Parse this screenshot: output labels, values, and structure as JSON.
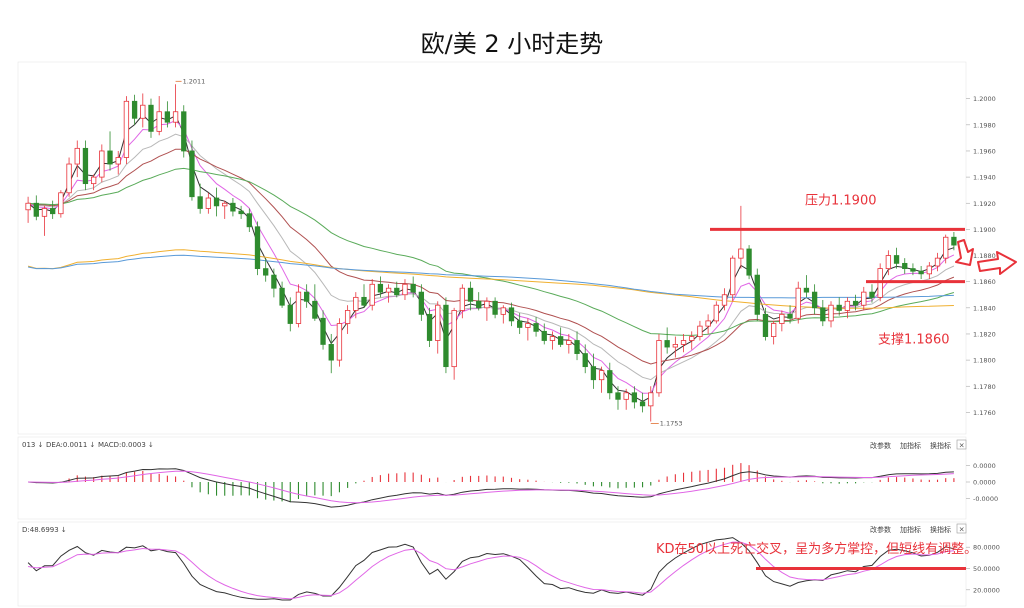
{
  "title": "欧/美 2 小时走势",
  "chart_data": {
    "type": "candlestick",
    "main_panel": {
      "ylim": [
        1.1745,
        1.2025
      ],
      "y_ticks": [
        "1.2000",
        "1.1980",
        "1.1960",
        "1.1940",
        "1.1920",
        "1.1900",
        "1.1880",
        "1.1860",
        "1.1840",
        "1.1820",
        "1.1800",
        "1.1780",
        "1.1760"
      ],
      "high_marker": "1.2011",
      "low_marker": "1.1753",
      "candles": [
        [
          1.1915,
          1.1925,
          1.1905,
          1.192
        ],
        [
          1.192,
          1.1926,
          1.1907,
          1.191
        ],
        [
          1.191,
          1.1918,
          1.1895,
          1.1916
        ],
        [
          1.1916,
          1.1922,
          1.1908,
          1.1912
        ],
        [
          1.1912,
          1.193,
          1.1909,
          1.1928
        ],
        [
          1.1928,
          1.1955,
          1.1925,
          1.195
        ],
        [
          1.195,
          1.1968,
          1.194,
          1.1962
        ],
        [
          1.1962,
          1.1968,
          1.193,
          1.1935
        ],
        [
          1.1935,
          1.1942,
          1.193,
          1.194
        ],
        [
          1.194,
          1.1965,
          1.1936,
          1.196
        ],
        [
          1.196,
          1.1975,
          1.1945,
          1.195
        ],
        [
          1.195,
          1.196,
          1.1942,
          1.1955
        ],
        [
          1.1955,
          1.2002,
          1.195,
          1.1998
        ],
        [
          1.1998,
          1.2003,
          1.198,
          1.1985
        ],
        [
          1.1985,
          1.2004,
          1.1978,
          1.1995
        ],
        [
          1.1995,
          1.2,
          1.197,
          1.1975
        ],
        [
          1.1975,
          1.2002,
          1.1972,
          1.199
        ],
        [
          1.199,
          1.1998,
          1.1978,
          1.1982
        ],
        [
          1.1982,
          1.2011,
          1.1978,
          1.199
        ],
        [
          1.199,
          1.1995,
          1.1955,
          1.196
        ],
        [
          1.196,
          1.1968,
          1.1922,
          1.1925
        ],
        [
          1.1925,
          1.1935,
          1.1912,
          1.1916
        ],
        [
          1.1916,
          1.1928,
          1.1912,
          1.1924
        ],
        [
          1.1924,
          1.1932,
          1.191,
          1.1918
        ],
        [
          1.1918,
          1.1922,
          1.1908,
          1.192
        ],
        [
          1.192,
          1.1924,
          1.191,
          1.1914
        ],
        [
          1.1914,
          1.1918,
          1.1908,
          1.1912
        ],
        [
          1.1912,
          1.1916,
          1.1898,
          1.1902
        ],
        [
          1.1902,
          1.1906,
          1.1865,
          1.187
        ],
        [
          1.187,
          1.1878,
          1.186,
          1.1865
        ],
        [
          1.1865,
          1.187,
          1.1848,
          1.1855
        ],
        [
          1.1855,
          1.186,
          1.184,
          1.1842
        ],
        [
          1.1842,
          1.1848,
          1.1822,
          1.1828
        ],
        [
          1.1828,
          1.1858,
          1.1825,
          1.1852
        ],
        [
          1.1852,
          1.1858,
          1.184,
          1.1845
        ],
        [
          1.1845,
          1.1858,
          1.183,
          1.1832
        ],
        [
          1.1832,
          1.1838,
          1.1808,
          1.1812
        ],
        [
          1.1812,
          1.182,
          1.179,
          1.18
        ],
        [
          1.18,
          1.1832,
          1.1795,
          1.1828
        ],
        [
          1.1828,
          1.1842,
          1.182,
          1.1838
        ],
        [
          1.1838,
          1.1852,
          1.1832,
          1.1848
        ],
        [
          1.1848,
          1.1858,
          1.184,
          1.1842
        ],
        [
          1.1842,
          1.1862,
          1.1838,
          1.1858
        ],
        [
          1.1858,
          1.1864,
          1.1848,
          1.1852
        ],
        [
          1.1852,
          1.1858,
          1.1844,
          1.1855
        ],
        [
          1.1855,
          1.186,
          1.1848,
          1.185
        ],
        [
          1.185,
          1.1862,
          1.1846,
          1.1858
        ],
        [
          1.1858,
          1.1864,
          1.1848,
          1.1852
        ],
        [
          1.1852,
          1.1858,
          1.183,
          1.1835
        ],
        [
          1.1835,
          1.184,
          1.181,
          1.1815
        ],
        [
          1.1815,
          1.1845,
          1.1805,
          1.1842
        ],
        [
          1.1842,
          1.1848,
          1.179,
          1.1795
        ],
        [
          1.1795,
          1.184,
          1.1785,
          1.1838
        ],
        [
          1.1838,
          1.1858,
          1.1832,
          1.1855
        ],
        [
          1.1855,
          1.186,
          1.1838,
          1.1845
        ],
        [
          1.1845,
          1.1852,
          1.1838,
          1.184
        ],
        [
          1.184,
          1.1848,
          1.183,
          1.1845
        ],
        [
          1.1845,
          1.1848,
          1.1832,
          1.1835
        ],
        [
          1.1835,
          1.1842,
          1.1828,
          1.184
        ],
        [
          1.184,
          1.1844,
          1.1826,
          1.183
        ],
        [
          1.183,
          1.1836,
          1.182,
          1.1825
        ],
        [
          1.1825,
          1.1832,
          1.1815,
          1.1828
        ],
        [
          1.1828,
          1.1833,
          1.1818,
          1.1822
        ],
        [
          1.1822,
          1.1828,
          1.1812,
          1.1815
        ],
        [
          1.1815,
          1.1822,
          1.1808,
          1.1818
        ],
        [
          1.1818,
          1.1825,
          1.181,
          1.1812
        ],
        [
          1.1812,
          1.182,
          1.1805,
          1.1815
        ],
        [
          1.1815,
          1.1822,
          1.18,
          1.1805
        ],
        [
          1.1805,
          1.1812,
          1.179,
          1.1795
        ],
        [
          1.1795,
          1.1805,
          1.1778,
          1.1785
        ],
        [
          1.1785,
          1.1795,
          1.1775,
          1.1792
        ],
        [
          1.1792,
          1.1798,
          1.177,
          1.1775
        ],
        [
          1.1775,
          1.178,
          1.1762,
          1.177
        ],
        [
          1.177,
          1.1778,
          1.1762,
          1.1775
        ],
        [
          1.1775,
          1.178,
          1.1763,
          1.1768
        ],
        [
          1.1768,
          1.1775,
          1.176,
          1.1765
        ],
        [
          1.1765,
          1.178,
          1.1753,
          1.1775
        ],
        [
          1.1775,
          1.182,
          1.1772,
          1.1815
        ],
        [
          1.1815,
          1.1825,
          1.1805,
          1.181
        ],
        [
          1.181,
          1.1818,
          1.1802,
          1.1812
        ],
        [
          1.1812,
          1.182,
          1.1806,
          1.1815
        ],
        [
          1.1815,
          1.1822,
          1.1808,
          1.1818
        ],
        [
          1.1818,
          1.183,
          1.1815,
          1.1826
        ],
        [
          1.1826,
          1.1835,
          1.182,
          1.183
        ],
        [
          1.183,
          1.1845,
          1.1828,
          1.1842
        ],
        [
          1.1842,
          1.1855,
          1.1838,
          1.185
        ],
        [
          1.185,
          1.188,
          1.1845,
          1.1878
        ],
        [
          1.1878,
          1.1918,
          1.187,
          1.1885
        ],
        [
          1.1885,
          1.1888,
          1.1862,
          1.1865
        ],
        [
          1.1865,
          1.187,
          1.183,
          1.1835
        ],
        [
          1.1835,
          1.184,
          1.1815,
          1.1818
        ],
        [
          1.1818,
          1.183,
          1.1812,
          1.1828
        ],
        [
          1.1828,
          1.1838,
          1.1822,
          1.1835
        ],
        [
          1.1835,
          1.1842,
          1.1828,
          1.1832
        ],
        [
          1.1832,
          1.186,
          1.1828,
          1.1855
        ],
        [
          1.1855,
          1.1865,
          1.1848,
          1.1852
        ],
        [
          1.1852,
          1.1858,
          1.1835,
          1.184
        ],
        [
          1.184,
          1.1846,
          1.1826,
          1.183
        ],
        [
          1.183,
          1.1845,
          1.1825,
          1.1842
        ],
        [
          1.1842,
          1.1848,
          1.1834,
          1.1838
        ],
        [
          1.1838,
          1.1848,
          1.1832,
          1.1845
        ],
        [
          1.1845,
          1.185,
          1.1838,
          1.1842
        ],
        [
          1.1842,
          1.1856,
          1.1838,
          1.1852
        ],
        [
          1.1852,
          1.1858,
          1.1844,
          1.1848
        ],
        [
          1.1848,
          1.1874,
          1.1845,
          1.187
        ],
        [
          1.187,
          1.1884,
          1.1865,
          1.188
        ],
        [
          1.188,
          1.1886,
          1.187,
          1.1874
        ],
        [
          1.1874,
          1.1878,
          1.1866,
          1.187
        ],
        [
          1.187,
          1.1874,
          1.1865,
          1.1868
        ],
        [
          1.1868,
          1.1872,
          1.1862,
          1.1866
        ],
        [
          1.1866,
          1.1875,
          1.1862,
          1.1872
        ],
        [
          1.1872,
          1.1882,
          1.1868,
          1.1878
        ],
        [
          1.1878,
          1.1896,
          1.1874,
          1.1894
        ],
        [
          1.1894,
          1.1898,
          1.1884,
          1.1888
        ]
      ]
    },
    "macd_panel": {
      "legend": [
        "013 ↓",
        "DEA:0.0011 ↓",
        "MACD:0.0003 ↓"
      ],
      "buttons": [
        "改参数",
        "加指标",
        "换指标",
        "×"
      ],
      "y_ticks": [
        "0.0000",
        "0.0000",
        "-0.0000"
      ],
      "ylim": [
        -0.0045,
        0.0045
      ]
    },
    "kd_panel": {
      "legend": [
        "D:48.6993 ↓"
      ],
      "buttons": [
        "改参数",
        "加指标",
        "换指标",
        "×"
      ],
      "y_ticks": [
        "80.0000",
        "50.0000",
        "20.0000"
      ],
      "ylim": [
        0,
        100
      ]
    }
  },
  "annotations": {
    "resistance_label": "压力1.1900",
    "resistance_level": 1.19,
    "support_label": "支撑1.1860",
    "support_level": 1.186,
    "kd_comment": "KD在50以上死亡交叉，呈为多方掌控，但短线有调整。",
    "kd_level": 50
  },
  "colors": {
    "up": "#e8323a",
    "down": "#2e8b2e",
    "annotation": "#e8323a",
    "ma_black": "#333333",
    "ma_pink": "#e066e6",
    "ma_silver": "#b8b8b8",
    "ma_brown": "#b05050",
    "ma_green": "#5aab5a",
    "ma_blue": "#5a9ad8",
    "ma_orange": "#f0b030"
  }
}
